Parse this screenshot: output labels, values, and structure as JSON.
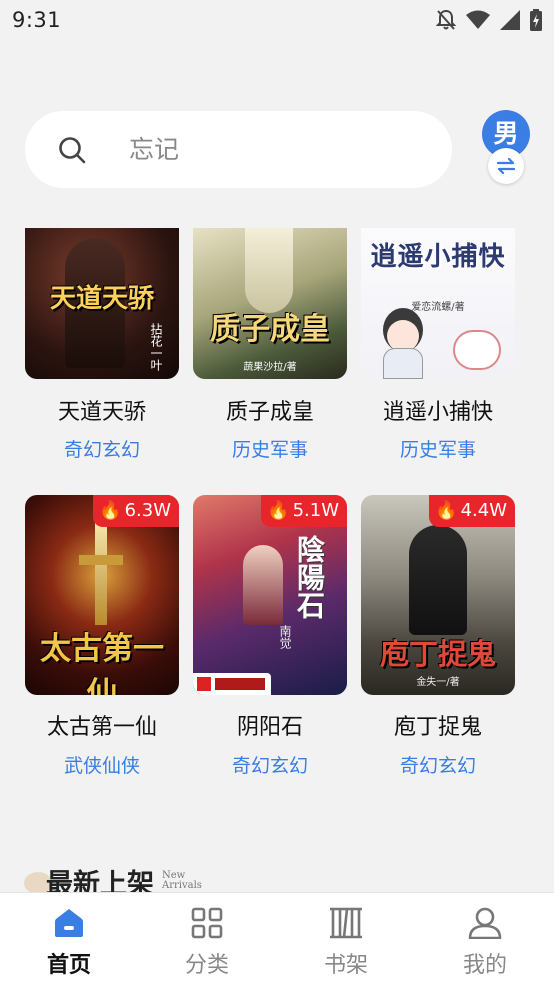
{
  "status_bar": {
    "time": "9:31"
  },
  "search": {
    "placeholder": "忘记"
  },
  "gender": {
    "label": "男"
  },
  "books": [
    {
      "title": "天道天骄",
      "genre": "奇幻玄幻",
      "cover_text": "天道天骄",
      "cover_sub": "拈花一叶",
      "heat": ""
    },
    {
      "title": "质子成皇",
      "genre": "历史军事",
      "cover_text": "质子成皇",
      "cover_sub": "蔬果沙拉/著",
      "heat": ""
    },
    {
      "title": "逍遥小捕快",
      "genre": "历史军事",
      "cover_text": "逍遥小捕快",
      "cover_sub": "爱恋流螺/著",
      "heat": ""
    },
    {
      "title": "太古第一仙",
      "genre": "武侠仙侠",
      "cover_text": "太古第一仙",
      "cover_sub": "",
      "heat": "6.3W"
    },
    {
      "title": "阴阳石",
      "genre": "奇幻玄幻",
      "cover_text": "陰陽石",
      "cover_sub": "南觉",
      "heat": "5.1W"
    },
    {
      "title": "庖丁捉鬼",
      "genre": "奇幻玄幻",
      "cover_text": "庖丁捉鬼",
      "cover_sub": "金失一/著",
      "heat": "4.4W"
    }
  ],
  "section": {
    "title": "最新上架",
    "subtitle_line1": "New",
    "subtitle_line2": "Arrivals"
  },
  "nav": [
    {
      "label": "首页",
      "icon": "home-icon",
      "active": true
    },
    {
      "label": "分类",
      "icon": "category-grid-icon",
      "active": false
    },
    {
      "label": "书架",
      "icon": "bookshelf-icon",
      "active": false
    },
    {
      "label": "我的",
      "icon": "profile-icon",
      "active": false
    }
  ],
  "colors": {
    "accent": "#3a7de3",
    "heat_badge": "#e8252b",
    "background": "#f2f2f2"
  }
}
